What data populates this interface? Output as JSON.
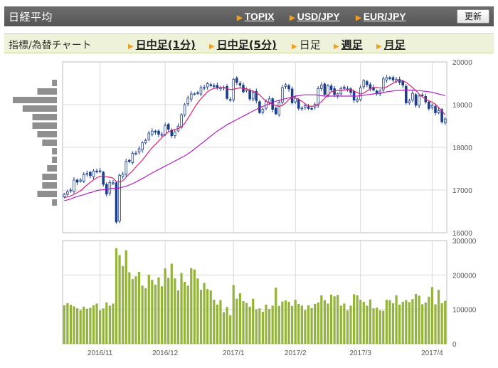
{
  "header": {
    "title": "日経平均",
    "links": [
      {
        "label": "TOPIX"
      },
      {
        "label": "USD/JPY"
      },
      {
        "label": "EUR/JPY"
      }
    ],
    "refresh_label": "更新"
  },
  "timeframe_bar": {
    "label": "指標/為替チャート",
    "options": [
      {
        "label": "日中足(1分)",
        "active": false
      },
      {
        "label": "日中足(5分)",
        "active": false
      },
      {
        "label": "日足",
        "active": true
      },
      {
        "label": "週足",
        "active": false
      },
      {
        "label": "月足",
        "active": false
      }
    ]
  },
  "colors": {
    "up_candle": "#ffffff",
    "down_candle": "#1a3d8f",
    "ma_short": "#e0206a",
    "ma_long": "#b020c0",
    "volume_bar": "#93b33a",
    "grid": "#d9d9d9",
    "price_by_volume": "#8f8f8f"
  },
  "chart_data": [
    {
      "type": "candlestick",
      "title": "",
      "xlabel": "",
      "ylabel": "",
      "ylim": [
        16000,
        20000
      ],
      "yticks": [
        "20000",
        "19000",
        "18000",
        "17000",
        "16000"
      ],
      "grid": true,
      "x_tick_labels": [
        "2016/11",
        "2016/12",
        "2017/1",
        "2017/2",
        "2017/3",
        "2017/4"
      ],
      "x_tick_dates": [
        "2016-11-01",
        "2016-12-01",
        "2017-01-04",
        "2017-02-01",
        "2017-03-01",
        "2017-04-03"
      ],
      "dates": [
        "2016-10-17",
        "2016-10-18",
        "2016-10-19",
        "2016-10-20",
        "2016-10-21",
        "2016-10-24",
        "2016-10-25",
        "2016-10-26",
        "2016-10-27",
        "2016-10-28",
        "2016-10-31",
        "2016-11-01",
        "2016-11-02",
        "2016-11-04",
        "2016-11-07",
        "2016-11-08",
        "2016-11-09",
        "2016-11-10",
        "2016-11-11",
        "2016-11-14",
        "2016-11-15",
        "2016-11-16",
        "2016-11-17",
        "2016-11-18",
        "2016-11-21",
        "2016-11-22",
        "2016-11-24",
        "2016-11-25",
        "2016-11-28",
        "2016-11-29",
        "2016-11-30",
        "2016-12-01",
        "2016-12-02",
        "2016-12-05",
        "2016-12-06",
        "2016-12-07",
        "2016-12-08",
        "2016-12-09",
        "2016-12-12",
        "2016-12-13",
        "2016-12-14",
        "2016-12-15",
        "2016-12-16",
        "2016-12-19",
        "2016-12-20",
        "2016-12-21",
        "2016-12-22",
        "2016-12-26",
        "2016-12-27",
        "2016-12-28",
        "2016-12-29",
        "2016-12-30",
        "2017-01-04",
        "2017-01-05",
        "2017-01-06",
        "2017-01-10",
        "2017-01-11",
        "2017-01-12",
        "2017-01-13",
        "2017-01-16",
        "2017-01-17",
        "2017-01-18",
        "2017-01-19",
        "2017-01-20",
        "2017-01-23",
        "2017-01-24",
        "2017-01-25",
        "2017-01-26",
        "2017-01-27",
        "2017-01-30",
        "2017-01-31",
        "2017-02-01",
        "2017-02-02",
        "2017-02-03",
        "2017-02-06",
        "2017-02-07",
        "2017-02-08",
        "2017-02-09",
        "2017-02-10",
        "2017-02-13",
        "2017-02-14",
        "2017-02-15",
        "2017-02-16",
        "2017-02-17",
        "2017-02-20",
        "2017-02-21",
        "2017-02-22",
        "2017-02-23",
        "2017-02-24",
        "2017-02-27",
        "2017-02-28",
        "2017-03-01",
        "2017-03-02",
        "2017-03-03",
        "2017-03-06",
        "2017-03-07",
        "2017-03-08",
        "2017-03-09",
        "2017-03-10",
        "2017-03-13",
        "2017-03-14",
        "2017-03-15",
        "2017-03-16",
        "2017-03-17",
        "2017-03-21",
        "2017-03-22",
        "2017-03-23",
        "2017-03-24",
        "2017-03-27",
        "2017-03-28",
        "2017-03-29",
        "2017-03-30",
        "2017-03-31",
        "2017-04-03",
        "2017-04-04",
        "2017-04-05",
        "2017-04-06",
        "2017-04-07"
      ],
      "close": [
        16900,
        16963,
        16998,
        17235,
        17184,
        17234,
        17365,
        17391,
        17336,
        17446,
        17425,
        17442,
        17134,
        16905,
        17177,
        17171,
        16251,
        17345,
        17374,
        17672,
        17668,
        17862,
        17863,
        17967,
        18106,
        18162,
        18333,
        18381,
        18356,
        18307,
        18308,
        18513,
        18426,
        18274,
        18360,
        18496,
        18765,
        18996,
        19155,
        19250,
        19253,
        19273,
        19401,
        19391,
        19494,
        19444,
        19427,
        19396,
        19403,
        19401,
        19145,
        19114,
        19594,
        19520,
        19454,
        19301,
        19364,
        19134,
        19287,
        19095,
        18813,
        18894,
        19072,
        19137,
        18891,
        18787,
        19057,
        19402,
        19467,
        19368,
        19041,
        19148,
        18914,
        18918,
        18976,
        18910,
        18908,
        19007,
        19378,
        19459,
        19238,
        19437,
        19348,
        19235,
        19251,
        19381,
        19380,
        19371,
        19283,
        19107,
        19119,
        19393,
        19564,
        19469,
        19379,
        19344,
        19254,
        19318,
        19604,
        19633,
        19609,
        19577,
        19590,
        19521,
        19455,
        19041,
        19085,
        19262,
        18985,
        19202,
        19217,
        19063,
        18909,
        18983,
        18810,
        18861,
        18597,
        18664
      ],
      "ma_short_approx": [
        16820,
        16840,
        16860,
        16900,
        16940,
        16980,
        17050,
        17120,
        17180,
        17240,
        17290,
        17320,
        17330,
        17310,
        17300,
        17280,
        17200,
        17190,
        17220,
        17300,
        17380,
        17450,
        17540,
        17620,
        17700,
        17800,
        17900,
        17990,
        18070,
        18150,
        18230,
        18300,
        18360,
        18400,
        18420,
        18440,
        18480,
        18560,
        18680,
        18800,
        18930,
        19040,
        19140,
        19220,
        19300,
        19350,
        19380,
        19390,
        19400,
        19400,
        19380,
        19350,
        19360,
        19380,
        19390,
        19380,
        19370,
        19340,
        19310,
        19280,
        19230,
        19150,
        19080,
        19040,
        19010,
        18980,
        18960,
        18980,
        19040,
        19120,
        19170,
        19160,
        19120,
        19080,
        19020,
        18970,
        18960,
        18970,
        19010,
        19070,
        19150,
        19230,
        19300,
        19320,
        19330,
        19330,
        19340,
        19350,
        19350,
        19320,
        19280,
        19250,
        19270,
        19320,
        19370,
        19400,
        19400,
        19390,
        19390,
        19410,
        19460,
        19500,
        19550,
        19560,
        19560,
        19520,
        19460,
        19400,
        19330,
        19250,
        19180,
        19130,
        19090,
        19060,
        19010,
        18930,
        18850,
        18760
      ],
      "ma_long_approx": [
        16750,
        16770,
        16790,
        16820,
        16850,
        16870,
        16890,
        16920,
        16940,
        16960,
        16990,
        17000,
        17010,
        17010,
        17030,
        17040,
        17040,
        17050,
        17070,
        17090,
        17120,
        17150,
        17190,
        17230,
        17270,
        17310,
        17360,
        17400,
        17440,
        17480,
        17520,
        17560,
        17600,
        17640,
        17680,
        17720,
        17760,
        17800,
        17850,
        17900,
        17960,
        18020,
        18080,
        18140,
        18200,
        18260,
        18320,
        18380,
        18430,
        18480,
        18530,
        18570,
        18610,
        18650,
        18690,
        18730,
        18770,
        18810,
        18850,
        18890,
        18930,
        18960,
        18990,
        19020,
        19050,
        19080,
        19100,
        19120,
        19140,
        19160,
        19180,
        19200,
        19210,
        19220,
        19230,
        19230,
        19230,
        19230,
        19220,
        19210,
        19200,
        19200,
        19200,
        19200,
        19200,
        19200,
        19200,
        19200,
        19200,
        19200,
        19200,
        19210,
        19220,
        19230,
        19240,
        19250,
        19260,
        19270,
        19280,
        19300,
        19310,
        19320,
        19330,
        19330,
        19340,
        19340,
        19340,
        19340,
        19330,
        19330,
        19320,
        19310,
        19300,
        19290,
        19270,
        19250,
        19230,
        19210
      ]
    },
    {
      "type": "bar",
      "title": "",
      "xlabel": "",
      "ylabel": "",
      "ylim": [
        0,
        300000
      ],
      "yticks": [
        "300000",
        "200000",
        "100000",
        "0"
      ],
      "grid": true,
      "values": [
        112000,
        118000,
        113000,
        109000,
        103000,
        98000,
        108000,
        102000,
        105000,
        112000,
        117000,
        97000,
        103000,
        120000,
        111000,
        117000,
        278000,
        258000,
        226000,
        272000,
        208000,
        188000,
        196000,
        209000,
        169000,
        162000,
        201000,
        186000,
        172000,
        193000,
        167000,
        219000,
        192000,
        233000,
        190000,
        155000,
        206000,
        180000,
        169000,
        220000,
        216000,
        190000,
        157000,
        177000,
        159000,
        155000,
        128000,
        114000,
        127000,
        92000,
        107000,
        83000,
        171000,
        131000,
        147000,
        124000,
        119000,
        108000,
        131000,
        100000,
        103000,
        93000,
        114000,
        101000,
        111000,
        163000,
        110000,
        123000,
        126000,
        122000,
        110000,
        128000,
        116000,
        111000,
        98000,
        112000,
        104000,
        116000,
        120000,
        141000,
        127000,
        117000,
        143000,
        138000,
        142000,
        111000,
        117000,
        97000,
        111000,
        144000,
        141000,
        128000,
        122000,
        111000,
        129000,
        103000,
        105000,
        97000,
        96000,
        128000,
        127000,
        118000,
        141000,
        114000,
        122000,
        127000,
        121000,
        130000,
        145000,
        140000,
        115000,
        120000,
        137000,
        165000,
        115000,
        157000,
        118000,
        125000
      ]
    },
    {
      "type": "bar",
      "title": "",
      "orientation": "horizontal",
      "price_levels": [
        19900,
        19700,
        19500,
        19300,
        19100,
        18900,
        18700,
        18500,
        18300,
        18100,
        17900,
        17700,
        17500,
        17300,
        17100,
        16900,
        16700,
        16500,
        16300
      ],
      "values": [
        0,
        0,
        1,
        4,
        9,
        7,
        5,
        5,
        4,
        3,
        1,
        1,
        2,
        3,
        3,
        4,
        1,
        0,
        0
      ]
    }
  ]
}
